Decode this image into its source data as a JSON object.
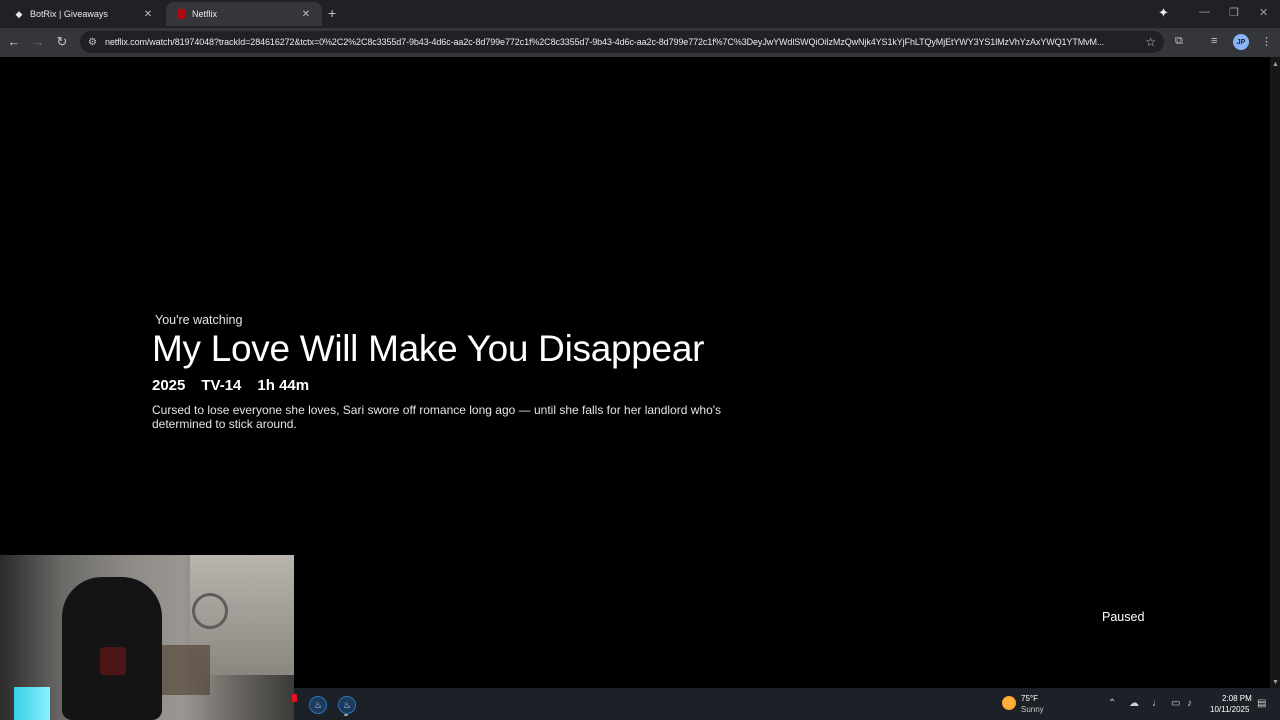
{
  "browser": {
    "tabs": [
      {
        "title": "BotRix | Giveaways",
        "favicon": "botrix-icon",
        "active": false
      },
      {
        "title": "Netflix",
        "favicon": "netflix-icon",
        "active": true
      }
    ],
    "url": "netflix.com/watch/81974048?trackId=284616272&tctx=0%2C2%2C8c3355d7-9b43-4d6c-aa2c-8d799e772c1f%2C8c3355d7-9b43-4d6c-aa2c-8d799e772c1f%7C%3DeyJwYWdlSWQiOiIzMzQwNjk4YS1kYjFhLTQyMjEtYWY3YS1lMzVhYzAxYWQ1YTMvM...",
    "profile_initials": "JP"
  },
  "player": {
    "watching_label": "You're watching",
    "title": "My Love Will Make You Disappear",
    "year": "2025",
    "rating": "TV-14",
    "duration": "1h 44m",
    "synopsis": "Cursed to lose everyone she loves, Sari swore off romance long ago — until she falls for her landlord who's determined to stick around.",
    "status": "Paused"
  },
  "taskbar": {
    "weather_temp": "75°F",
    "weather_condition": "Sunny",
    "time": "2:08 PM",
    "date": "10/11/2025"
  }
}
